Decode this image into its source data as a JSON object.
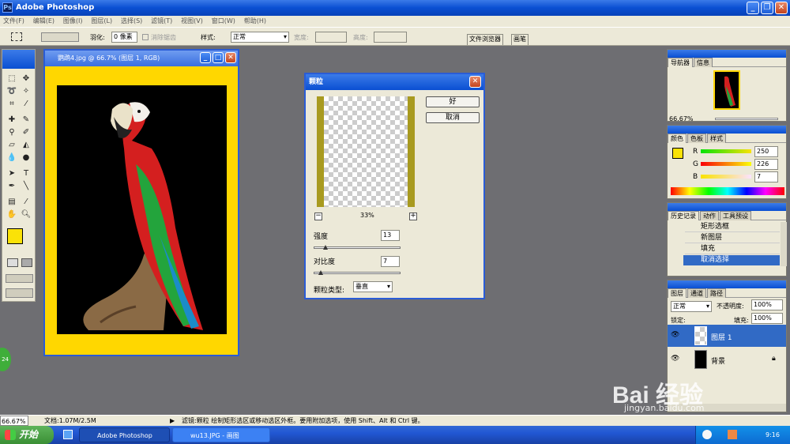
{
  "app": {
    "title": "Adobe Photoshop"
  },
  "menu": [
    "文件(F)",
    "编辑(E)",
    "图像(I)",
    "图层(L)",
    "选择(S)",
    "滤镜(T)",
    "视图(V)",
    "窗口(W)",
    "帮助(H)"
  ],
  "options": {
    "feather_label": "羽化:",
    "feather_value": "0 像素",
    "antialias_label": "消除锯齿",
    "style_label": "样式:",
    "style_value": "正常",
    "width_label": "宽度:",
    "height_label": "高度:",
    "tab_file_browser": "文件浏览器",
    "tab_brushes": "画笔"
  },
  "document": {
    "title": "鹦鹉4.jpg @ 66.7% (图层 1, RGB)"
  },
  "dialog": {
    "title": "颗粒",
    "ok_label": "好",
    "cancel_label": "取消",
    "zoom": "33%",
    "intensity_label": "强度",
    "intensity_value": "13",
    "contrast_label": "对比度",
    "contrast_value": "7",
    "grain_type_label": "颗粒类型:",
    "grain_type_value": "垂直"
  },
  "navigator": {
    "tabs": [
      "导航器",
      "信息"
    ],
    "zoom": "66.67%"
  },
  "color": {
    "tabs": [
      "颜色",
      "色板",
      "样式"
    ],
    "r_label": "R",
    "r_value": "250",
    "g_label": "G",
    "g_value": "226",
    "b_label": "B",
    "b_value": "7",
    "foreground": "#fae207"
  },
  "history": {
    "tabs": [
      "历史记录",
      "动作",
      "工具预设"
    ],
    "items": [
      "矩形选框",
      "新图层",
      "填充",
      "取消选择"
    ]
  },
  "layers": {
    "tabs": [
      "图层",
      "通道",
      "路径"
    ],
    "blend_mode": "正常",
    "opacity_label": "不透明度:",
    "opacity_value": "100%",
    "lock_label": "锁定:",
    "fill_label": "填充:",
    "fill_value": "100%",
    "items": [
      {
        "name": "图层 1"
      },
      {
        "name": "背景"
      }
    ]
  },
  "status": {
    "zoom": "66.67%",
    "doc_size": "文档:1.07M/2.5M",
    "message": "滤镜:颗粒  绘制矩形选区或移动选区外框。要用附加选项，使用 Shift、Alt 和 Ctrl 键。"
  },
  "taskbar": {
    "start_label": "开始",
    "task1": "Adobe Photoshop",
    "task2": "wu13.JPG - 画图",
    "clock": "9:16"
  },
  "watermark": {
    "line1": "Bai 经验",
    "line2": "jingyan.baidu.com"
  },
  "badge": {
    "value": "24"
  }
}
